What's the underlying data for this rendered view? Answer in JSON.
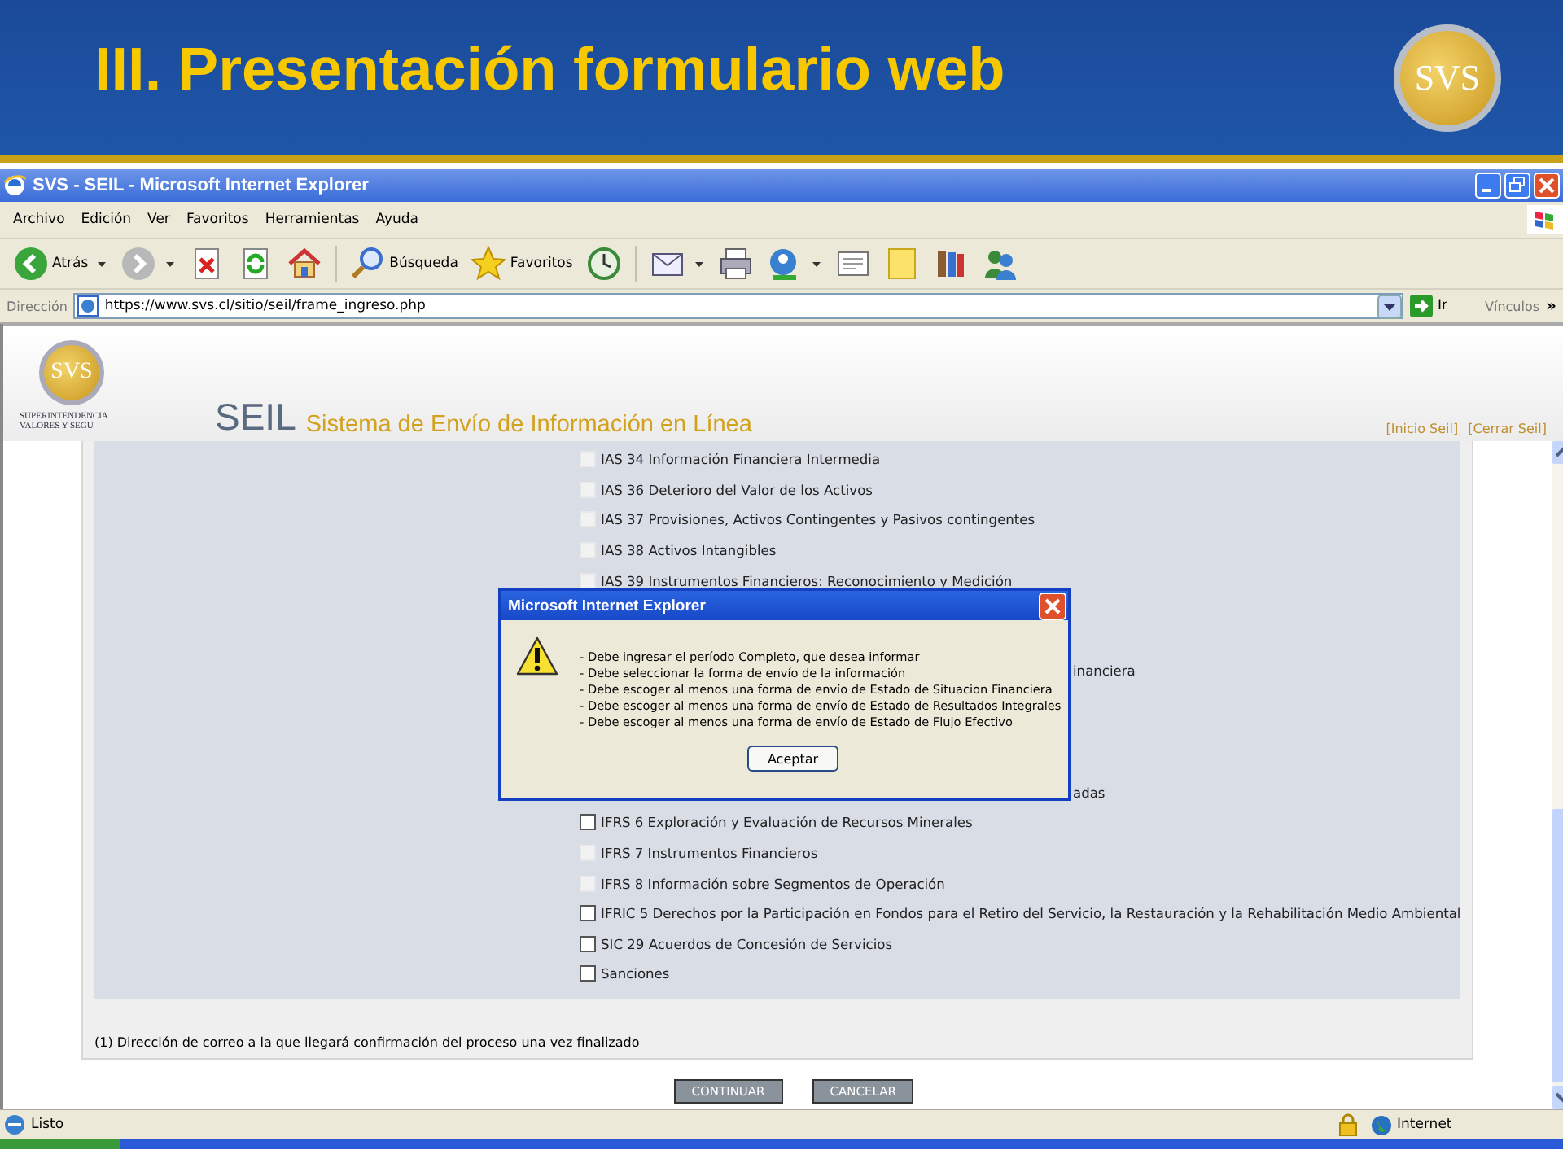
{
  "slide": {
    "title": "III. Presentación formulario web",
    "logo": "SVS"
  },
  "window": {
    "title": "SVS - SEIL - Microsoft Internet Explorer"
  },
  "menu": [
    "Archivo",
    "Edición",
    "Ver",
    "Favoritos",
    "Herramientas",
    "Ayuda"
  ],
  "toolbar": [
    {
      "kind": "back",
      "label": "Atrás",
      "dropdown": true
    },
    {
      "kind": "forward",
      "dropdown": true
    },
    {
      "kind": "stop"
    },
    {
      "kind": "refresh"
    },
    {
      "kind": "home"
    },
    {
      "kind": "search",
      "label": "Búsqueda"
    },
    {
      "kind": "favorites",
      "label": "Favoritos"
    },
    {
      "kind": "history"
    },
    {
      "kind": "mail",
      "dropdown": true
    },
    {
      "kind": "print"
    },
    {
      "kind": "messenger",
      "dropdown": true
    },
    {
      "kind": "edit"
    },
    {
      "kind": "note"
    },
    {
      "kind": "research"
    },
    {
      "kind": "people"
    }
  ],
  "address": {
    "label": "Dirección",
    "url": "https://www.svs.cl/sitio/seil/frame_ingreso.php",
    "go": "Ir",
    "links": "Vínculos",
    "more": "»"
  },
  "site_header": {
    "logo": "SVS",
    "org": [
      "SUPERINTENDENCIA",
      "VALORES Y SEGU"
    ],
    "brand": "SEIL",
    "subtitle": "Sistema de Envío de Información en Línea",
    "links": [
      "[Inicio Seil]",
      "[Cerrar Seil]"
    ]
  },
  "options": [
    {
      "kind": "option",
      "label": "IAS 34 Información Financiera Intermedia",
      "disabled": true
    },
    {
      "kind": "option",
      "label": "IAS 36 Deterioro del Valor de los Activos",
      "disabled": true
    },
    {
      "kind": "option",
      "label": "IAS 37 Provisiones, Activos Contingentes y Pasivos contingentes",
      "disabled": true
    },
    {
      "kind": "option",
      "label": "IAS 38 Activos Intangibles",
      "disabled": true
    },
    {
      "kind": "option",
      "label": "IAS 39 Instrumentos Financieros: Reconocimiento y Medición",
      "disabled": true
    },
    {
      "kind": "covered"
    },
    {
      "kind": "covered"
    },
    {
      "kind": "covered",
      "label": "inanciera"
    },
    {
      "kind": "covered"
    },
    {
      "kind": "covered"
    },
    {
      "kind": "covered"
    },
    {
      "kind": "covered",
      "label": "adas"
    },
    {
      "kind": "option",
      "label": "IFRS 6 Exploración y Evaluación de Recursos Minerales",
      "disabled": false
    },
    {
      "kind": "option",
      "label": "IFRS 7 Instrumentos Financieros",
      "disabled": true
    },
    {
      "kind": "option",
      "label": "IFRS 8 Información sobre Segmentos de Operación",
      "disabled": true
    },
    {
      "kind": "option",
      "label": "IFRIC 5 Derechos por la Participación en Fondos para el Retiro del Servicio, la Restauración y la Rehabilitación Medio Ambiental",
      "disabled": false
    },
    {
      "kind": "option",
      "label": "SIC 29 Acuerdos de Concesión de Servicios",
      "disabled": false
    },
    {
      "kind": "option",
      "label": "Sanciones",
      "disabled": false
    }
  ],
  "footnote": "(1) Dirección de correo a la que llegará confirmación del proceso una vez finalizado",
  "buttons": [
    "CONTINUAR",
    "CANCELAR"
  ],
  "dialog": {
    "title": "Microsoft Internet Explorer",
    "lines": [
      "- Debe ingresar el período Completo, que desea informar",
      "- Debe seleccionar la forma de envío de la información",
      "- Debe escoger al menos una forma de envío de Estado de Situacion Financiera",
      "- Debe escoger al menos una forma de envío de Estado de Resultados Integrales",
      "- Debe escoger al menos una forma de envío de Estado de Flujo Efectivo"
    ],
    "button": "Aceptar"
  },
  "status_bar": {
    "text": "Listo",
    "zone": "Internet"
  }
}
